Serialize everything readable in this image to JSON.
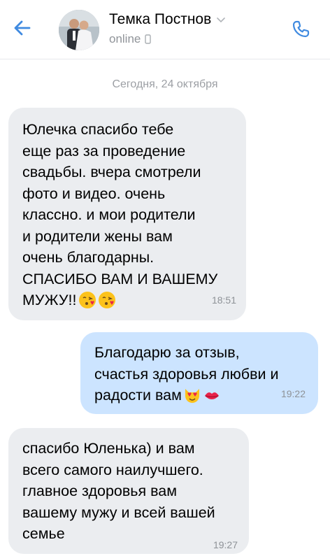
{
  "header": {
    "contact_name": "Темка Постнов",
    "status": "online",
    "back_icon": "arrow-left-icon",
    "call_icon": "phone-call-icon",
    "accent_color": "#3f8ae0"
  },
  "chat": {
    "date_separator": "Сегодня, 24 октября",
    "messages": [
      {
        "direction": "incoming",
        "text": "Юлечка спасибо тебе\nеще раз за проведение\nсвадьбы.  вчера смотрели\nфото и видео.  очень\nклассно.  и мои родители\nи родители  жены  вам\nочень благодарны.\nСПАСИБО ВАМ И ВАШЕМУ\nМУЖУ!!",
        "emojis": [
          "kissing-face-emoji",
          "kissing-face-emoji"
        ],
        "time": "18:51"
      },
      {
        "direction": "outgoing",
        "text": "Благодарю за отзыв,\nсчастья здоровья любви и\nрадости вам",
        "emojis": [
          "heart-eyes-cat-emoji",
          "kiss-mark-emoji"
        ],
        "time": "19:22"
      },
      {
        "direction": "incoming",
        "text": "спасибо  Юленька) и вам\nвсего самого наилучшего.\nглавное здоровья  вам\nвашему мужу и всей вашей\nсемье",
        "emojis": [],
        "time": "19:27"
      }
    ]
  }
}
